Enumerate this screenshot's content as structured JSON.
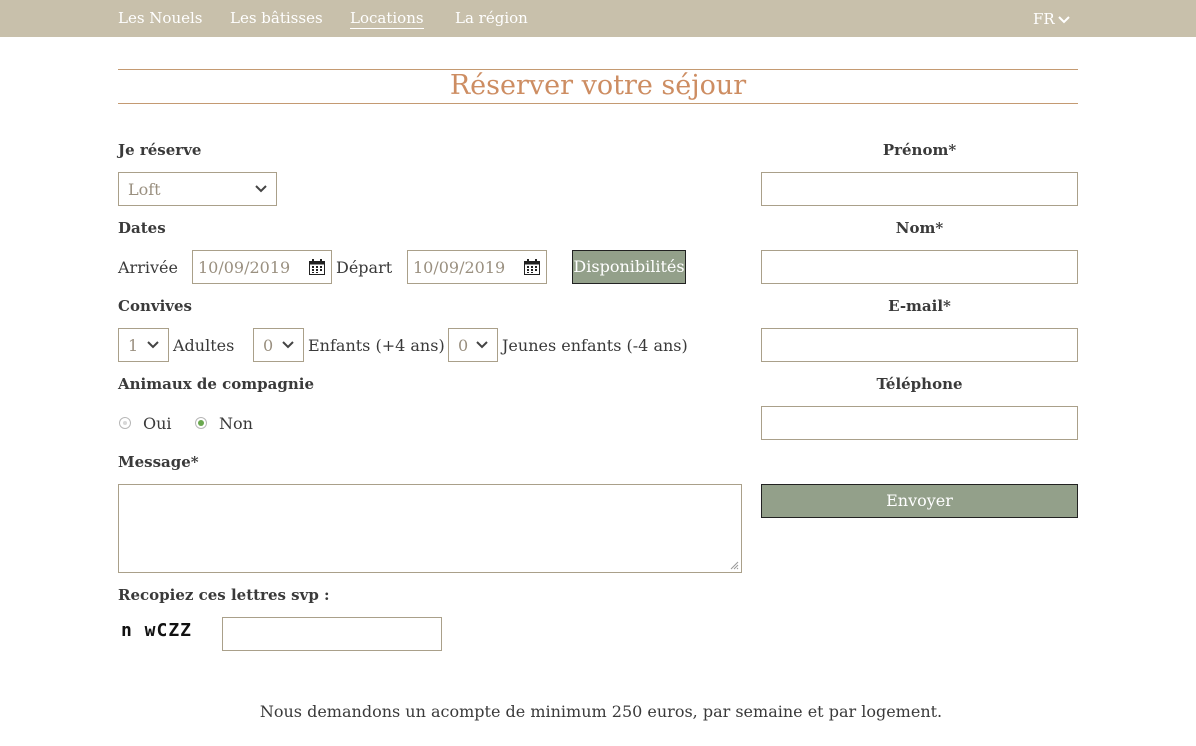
{
  "nav": {
    "items": [
      "Les Nouels",
      "Les bâtisses",
      "Locations",
      "La région"
    ],
    "active": "Locations",
    "language": "FR"
  },
  "page_title": "Réserver votre séjour",
  "form": {
    "je_reserve_label": "Je réserve",
    "logement_value": "Loft",
    "dates_label": "Dates",
    "arrivee_label": "Arrivée",
    "arrivee_value": "10/09/2019",
    "depart_label": "Départ",
    "depart_value": "10/09/2019",
    "dispo_button": "Disponibilités",
    "convives_label": "Convives",
    "adultes_value": "1",
    "adultes_label": "Adultes",
    "enfants_value": "0",
    "enfants_label": "Enfants (+4 ans)",
    "jeunes_value": "0",
    "jeunes_label": "Jeunes enfants (-4 ans)",
    "animaux_label": "Animaux de compagnie",
    "oui_label": "Oui",
    "non_label": "Non",
    "animaux_selected": "Non",
    "message_label": "Message*",
    "message_value": "",
    "prenom_label": "Prénom*",
    "nom_label": "Nom*",
    "email_label": "E-mail*",
    "telephone_label": "Téléphone",
    "envoyer_button": "Envoyer",
    "captcha_label": "Recopiez ces lettres svp :",
    "captcha_text": "n wCZZ",
    "captcha_value": ""
  },
  "footer_note": "Nous demandons un acompte de minimum 250 euros, par semaine et par logement.",
  "colors": {
    "nav_bg": "#c8c0ab",
    "title": "#cd8d62",
    "button_bg": "#93a08a",
    "radio_selected": "#6aa84f"
  }
}
